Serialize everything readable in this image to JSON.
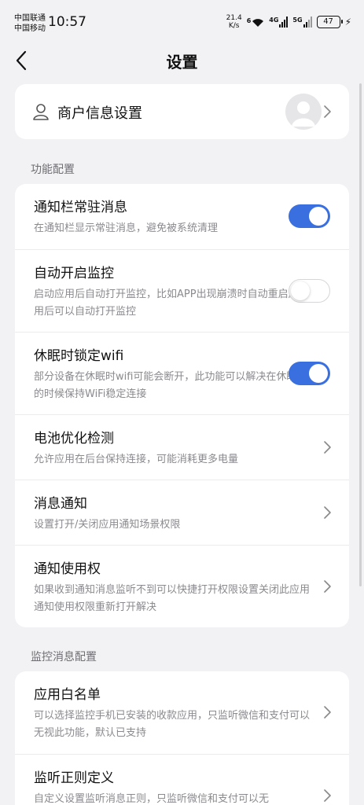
{
  "status_bar": {
    "carrier1": "中国联通",
    "carrier2": "中国移动",
    "time": "10:57",
    "speed_value": "21.4",
    "speed_unit": "K/s",
    "wifi_label": "6",
    "net1_label": "4G",
    "net2_label": "5G",
    "battery": "47"
  },
  "nav": {
    "title": "设置"
  },
  "merchant": {
    "label": "商户信息设置"
  },
  "sections": {
    "function_config": "功能配置",
    "monitor_config": "监控消息配置"
  },
  "function_items": [
    {
      "title": "通知栏常驻消息",
      "desc": "在通知栏显示常驻消息，避免被系统清理",
      "control": "toggle",
      "on": true
    },
    {
      "title": "自动开启监控",
      "desc": "启动应用后自动打开监控，比如APP出现崩溃时自动重启应用后可以自动打开监控",
      "control": "toggle",
      "on": false
    },
    {
      "title": "休眠时锁定wifi",
      "desc": "部分设备在休眠时wifi可能会断开，此功能可以解决在休眠的时候保持WiFi稳定连接",
      "control": "toggle",
      "on": true
    },
    {
      "title": "电池优化检测",
      "desc": "允许应用在后台保持连接，可能消耗更多电量",
      "control": "chevron"
    },
    {
      "title": "消息通知",
      "desc": "设置打开/关闭应用通知场景权限",
      "control": "chevron"
    },
    {
      "title": "通知使用权",
      "desc": "如果收到通知消息监听不到可以快捷打开权限设置关闭此应用通知使用权限重新打开解决",
      "control": "chevron"
    }
  ],
  "monitor_items": [
    {
      "title": "应用白名单",
      "desc": "可以选择监控手机已安装的收款应用，只监听微信和支付可以无视此功能，默认已支持",
      "control": "chevron"
    },
    {
      "title": "监听正则定义",
      "desc": "自定义设置监听消息正则，只监听微信和支付可以无",
      "control": "chevron"
    }
  ],
  "colors": {
    "accent": "#3a6fe0",
    "background": "#f2f2f4",
    "card": "#ffffff"
  }
}
